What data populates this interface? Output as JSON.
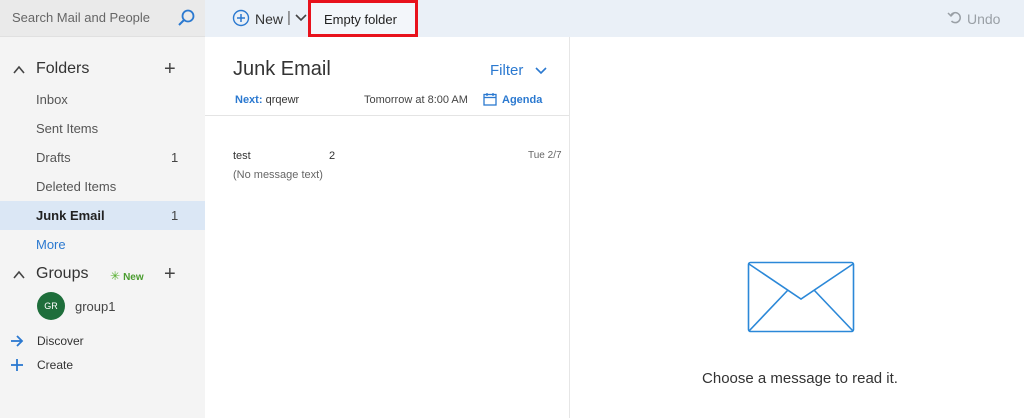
{
  "search": {
    "placeholder": "Search Mail and People",
    "icon": "search-icon"
  },
  "toolbar": {
    "new_label": "New",
    "separator": "|",
    "empty_folder_label": "Empty folder",
    "undo_label": "Undo",
    "highlight_color": "#e8121c"
  },
  "sidebar": {
    "folders_title": "Folders",
    "folders": [
      {
        "label": "Inbox",
        "count": ""
      },
      {
        "label": "Sent Items",
        "count": ""
      },
      {
        "label": "Drafts",
        "count": "1"
      },
      {
        "label": "Deleted Items",
        "count": ""
      },
      {
        "label": "Junk Email",
        "count": "1",
        "selected": true
      }
    ],
    "more_label": "More",
    "groups_title": "Groups",
    "groups_new_badge": "New",
    "groups": [
      {
        "initials": "GR",
        "name": "group1"
      }
    ],
    "discover_label": "Discover",
    "create_label": "Create"
  },
  "list": {
    "title": "Junk Email",
    "filter_label": "Filter",
    "next_key": "Next:",
    "next_subject": "qrqewr",
    "next_time": "Tomorrow at 8:00 AM",
    "agenda_label": "Agenda",
    "messages": [
      {
        "sender": "test",
        "extra": "2",
        "date": "Tue 2/7",
        "preview": "(No message text)"
      }
    ]
  },
  "reading": {
    "empty_text": "Choose a message to read it."
  },
  "colors": {
    "accent": "#2b79d0",
    "selected_bg": "#dbe7f5",
    "toolbar_bg": "#eaf0f7",
    "avatar": "#1e6e3b"
  }
}
